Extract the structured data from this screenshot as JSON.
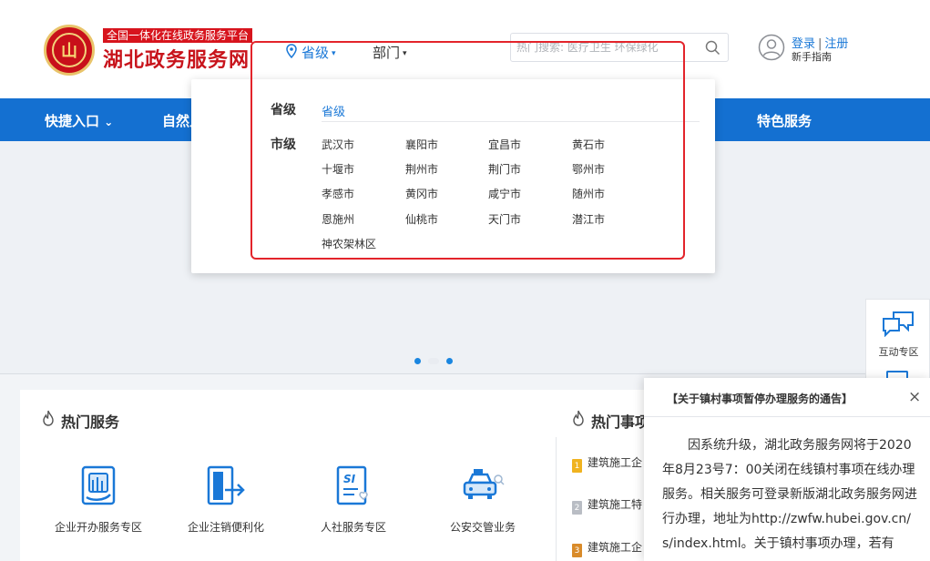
{
  "header": {
    "logo_tag": "全国一体化在线政务服务平台",
    "logo_title": "湖北政务服务网",
    "logo_emblem_text": "山",
    "region_selector": "省级",
    "dept_selector": "部门",
    "search": {
      "placeholder": "热门搜索: 医疗卫生 环保绿化"
    },
    "login": "登录",
    "register": "注册",
    "login_separator": "|",
    "guide": "新手指南"
  },
  "nav": {
    "items": [
      "快捷入口",
      "自然人",
      "特色服务"
    ],
    "quick_caret": "⌄"
  },
  "dropdown": {
    "province_label": "省级",
    "province_link": "省级",
    "city_label": "市级",
    "cities": [
      "武汉市",
      "襄阳市",
      "宜昌市",
      "黄石市",
      "十堰市",
      "荆州市",
      "荆门市",
      "鄂州市",
      "孝感市",
      "黄冈市",
      "咸宁市",
      "随州市",
      "恩施州",
      "仙桃市",
      "天门市",
      "潜江市",
      "神农架林区"
    ]
  },
  "float_panel": {
    "label": "互动专区"
  },
  "hot_services": {
    "title": "热门服务",
    "items": [
      "企业开办服务专区",
      "企业注销便利化",
      "人社服务专区",
      "公安交管业务"
    ]
  },
  "hot_matters": {
    "title": "热门事项",
    "items": [
      "建筑施工企",
      "建筑施工特",
      "建筑施工企"
    ],
    "ranks": [
      "1",
      "2",
      "3"
    ]
  },
  "notice": {
    "title": "【关于镇村事项暂停办理服务的通告】",
    "close": "×",
    "body": "因系统升级，湖北政务服务网将于2020年8月23号7：00关闭在线镇村事项在线办理服务。相关服务可登录新版湖北政务服务网进行办理，地址为http://zwfw.hubei.gov.cn/s/index.html。关于镇村事项办理，若有"
  },
  "colors": {
    "primary_blue": "#1470d1",
    "link_blue": "#1a78d7",
    "brand_red": "#c8141c",
    "highlight_red": "#e3242b"
  }
}
